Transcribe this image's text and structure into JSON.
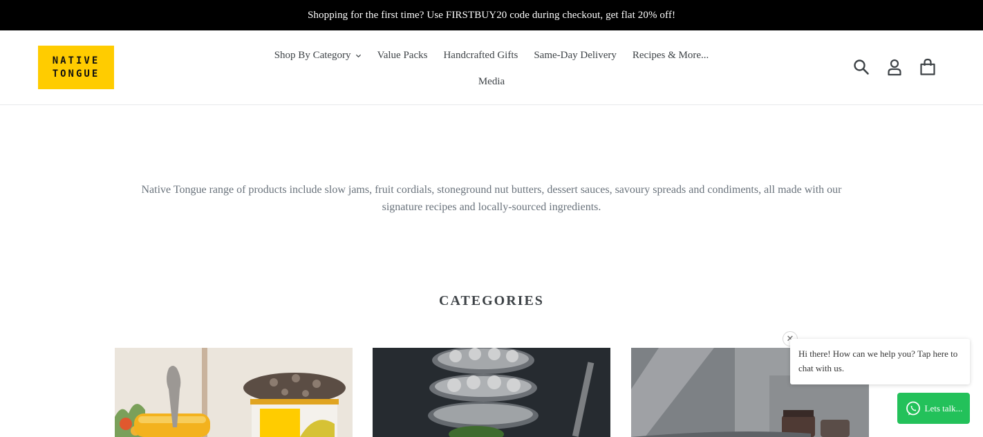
{
  "announcement": {
    "text": "Shopping for the first time? Use FIRSTBUY20 code during checkout, get flat 20% off!"
  },
  "brand": {
    "logo_line1": "NATIVE",
    "logo_line2": "TONGUE",
    "logo_color": "#ffcc00"
  },
  "nav": {
    "items": [
      {
        "label": "Shop By Category",
        "has_dropdown": true
      },
      {
        "label": "Value Packs"
      },
      {
        "label": "Handcrafted Gifts"
      },
      {
        "label": "Same-Day Delivery"
      },
      {
        "label": "Recipes & More..."
      },
      {
        "label": "Media"
      }
    ]
  },
  "header_icons": [
    "search-icon",
    "account-icon",
    "cart-icon"
  ],
  "intro": {
    "text": "Native Tongue range of products include slow jams, fruit cordials, stoneground nut butters, dessert sauces, savoury spreads and condiments, all made with our signature recipes and locally-sourced ingredients."
  },
  "categories": {
    "title": "CATEGORIES"
  },
  "chat": {
    "message": "Hi there! How can we help you? Tap here to chat with us.",
    "button_label": "Lets talk...",
    "button_color": "#23c15a"
  }
}
